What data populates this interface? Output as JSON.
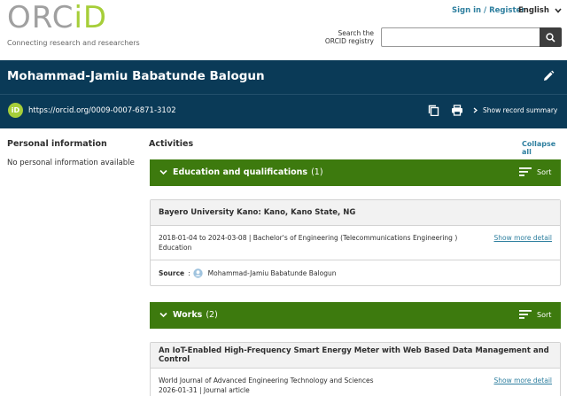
{
  "header": {
    "logo_prefix": "ORC",
    "logo_suffix": "iD",
    "tagline": "Connecting research and researchers",
    "signin": "Sign in / Register",
    "language": "English",
    "search_label_line1": "Search the",
    "search_label_line2": "ORCID registry",
    "search_value": ""
  },
  "profile": {
    "name": "Mohammad-Jamiu Babatunde Balogun",
    "id_badge": "iD",
    "orcid_url": "https://orcid.org/0009-0007-6871-3102",
    "show_summary": "Show record summary"
  },
  "personal": {
    "title": "Personal information",
    "empty": "No personal information available"
  },
  "activities": {
    "title": "Activities",
    "collapse_all": "Collapse all",
    "education": {
      "label": "Education and qualifications",
      "count": "(1)",
      "sort": "Sort",
      "item": {
        "institution": "Bayero University Kano: Kano, Kano State, NG",
        "dates_degree": "2018-01-04 to 2024-03-08 | Bachelor's of Engineering (Telecommunications Engineering )",
        "type": "Education",
        "show_more": "Show more detail",
        "source_label": "Source",
        "source_sep": ":",
        "source_value": "Mohammad-Jamiu Babatunde Balogun"
      }
    },
    "works": {
      "label": "Works",
      "count": "(2)",
      "sort": "Sort",
      "item": {
        "title": "An IoT-Enabled High-Frequency Smart Energy Meter with Web Based Data Management and Control",
        "journal": "World Journal of Advanced Engineering Technology and Sciences",
        "date_type": "2026-01-31 | Journal article",
        "show_more": "Show more detail"
      }
    }
  },
  "colors": {
    "orcid_green": "#a6ce39",
    "hero_navy": "#0a3a57",
    "section_green": "#3d7a0e",
    "link_blue": "#2e7f9f"
  }
}
